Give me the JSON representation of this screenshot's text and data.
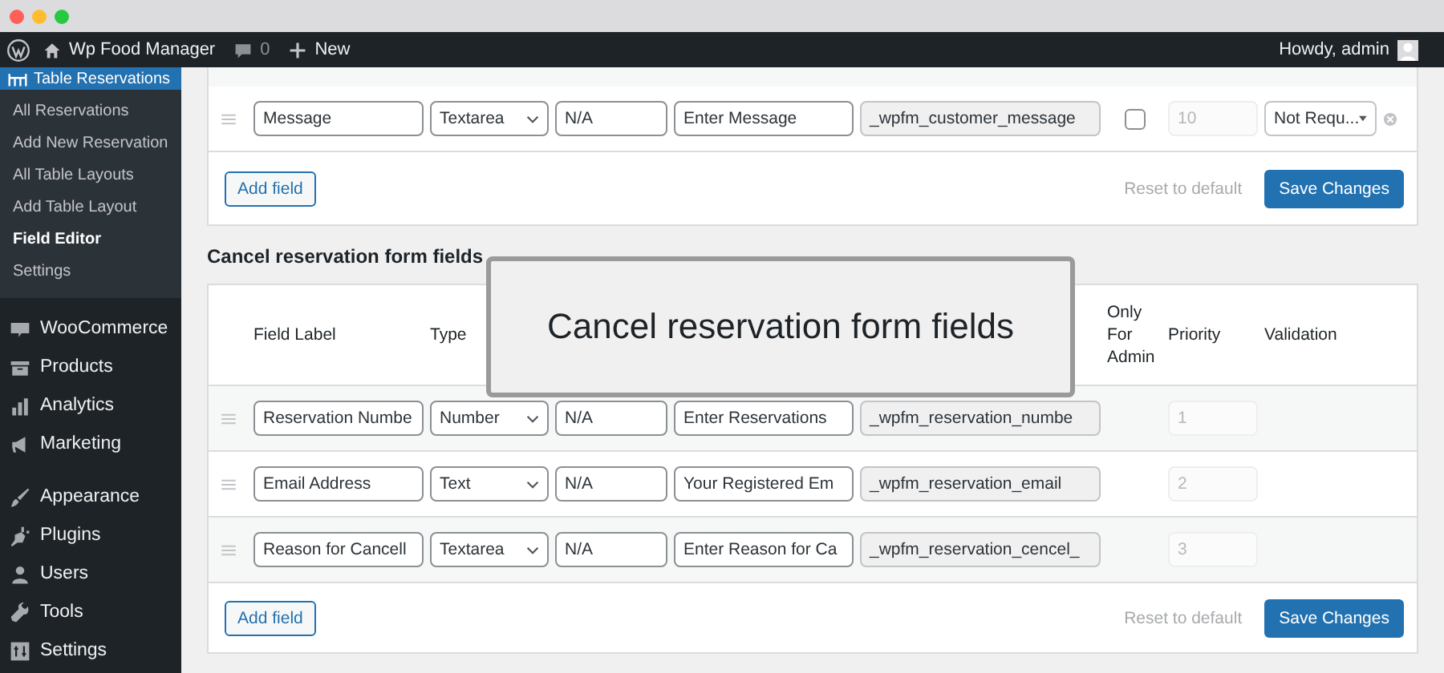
{
  "admin_bar": {
    "site_name": "Wp Food Manager",
    "comments": "0",
    "new_label": "New",
    "greeting": "Howdy, admin"
  },
  "sidebar": {
    "menu_header": "Table Reservations",
    "submenu": [
      {
        "label": "All Reservations",
        "selected": false
      },
      {
        "label": "Add New Reservation",
        "selected": false
      },
      {
        "label": "All Table Layouts",
        "selected": false
      },
      {
        "label": "Add Table Layout",
        "selected": false
      },
      {
        "label": "Field Editor",
        "selected": true
      },
      {
        "label": "Settings",
        "selected": false
      }
    ],
    "groups": [
      [
        {
          "label": "WooCommerce",
          "kind": "woo"
        },
        {
          "label": "Products",
          "kind": "products"
        },
        {
          "label": "Analytics",
          "kind": "analytics"
        },
        {
          "label": "Marketing",
          "kind": "marketing"
        }
      ],
      [
        {
          "label": "Appearance",
          "kind": "appearance"
        },
        {
          "label": "Plugins",
          "kind": "plugins"
        },
        {
          "label": "Users",
          "kind": "users"
        },
        {
          "label": "Tools",
          "kind": "tools"
        },
        {
          "label": "Settings",
          "kind": "settings"
        }
      ]
    ]
  },
  "top_form": {
    "rows": [
      {
        "label": "Message",
        "type": "Textarea",
        "default": "N/A",
        "placeholder": "Enter Message",
        "meta_key": "_wpfm_customer_message",
        "admin_only": false,
        "priority": "10",
        "validation": "Not Requ...",
        "removable": true
      }
    ],
    "add_field": "Add field",
    "reset": "Reset to default",
    "save": "Save Changes"
  },
  "cancel_form": {
    "heading": "Cancel reservation form fields",
    "columns": {
      "label": "Field Label",
      "type": "Type",
      "admin": "Only For Admin",
      "priority": "Priority",
      "validation": "Validation"
    },
    "rows": [
      {
        "label": "Reservation Numbe",
        "type": "Number",
        "default": "N/A",
        "placeholder": "Enter Reservations",
        "meta_key": "_wpfm_reservation_numbe",
        "priority": "1"
      },
      {
        "label": "Email Address",
        "type": "Text",
        "default": "N/A",
        "placeholder": "Your Registered Em",
        "meta_key": "_wpfm_reservation_email",
        "priority": "2"
      },
      {
        "label": "Reason for Cancell",
        "type": "Textarea",
        "default": "N/A",
        "placeholder": "Enter Reason for Ca",
        "meta_key": "_wpfm_reservation_cencel_",
        "priority": "3"
      }
    ],
    "add_field": "Add field",
    "reset": "Reset to default",
    "save": "Save Changes"
  },
  "callout": {
    "text": "Cancel reservation form fields"
  }
}
